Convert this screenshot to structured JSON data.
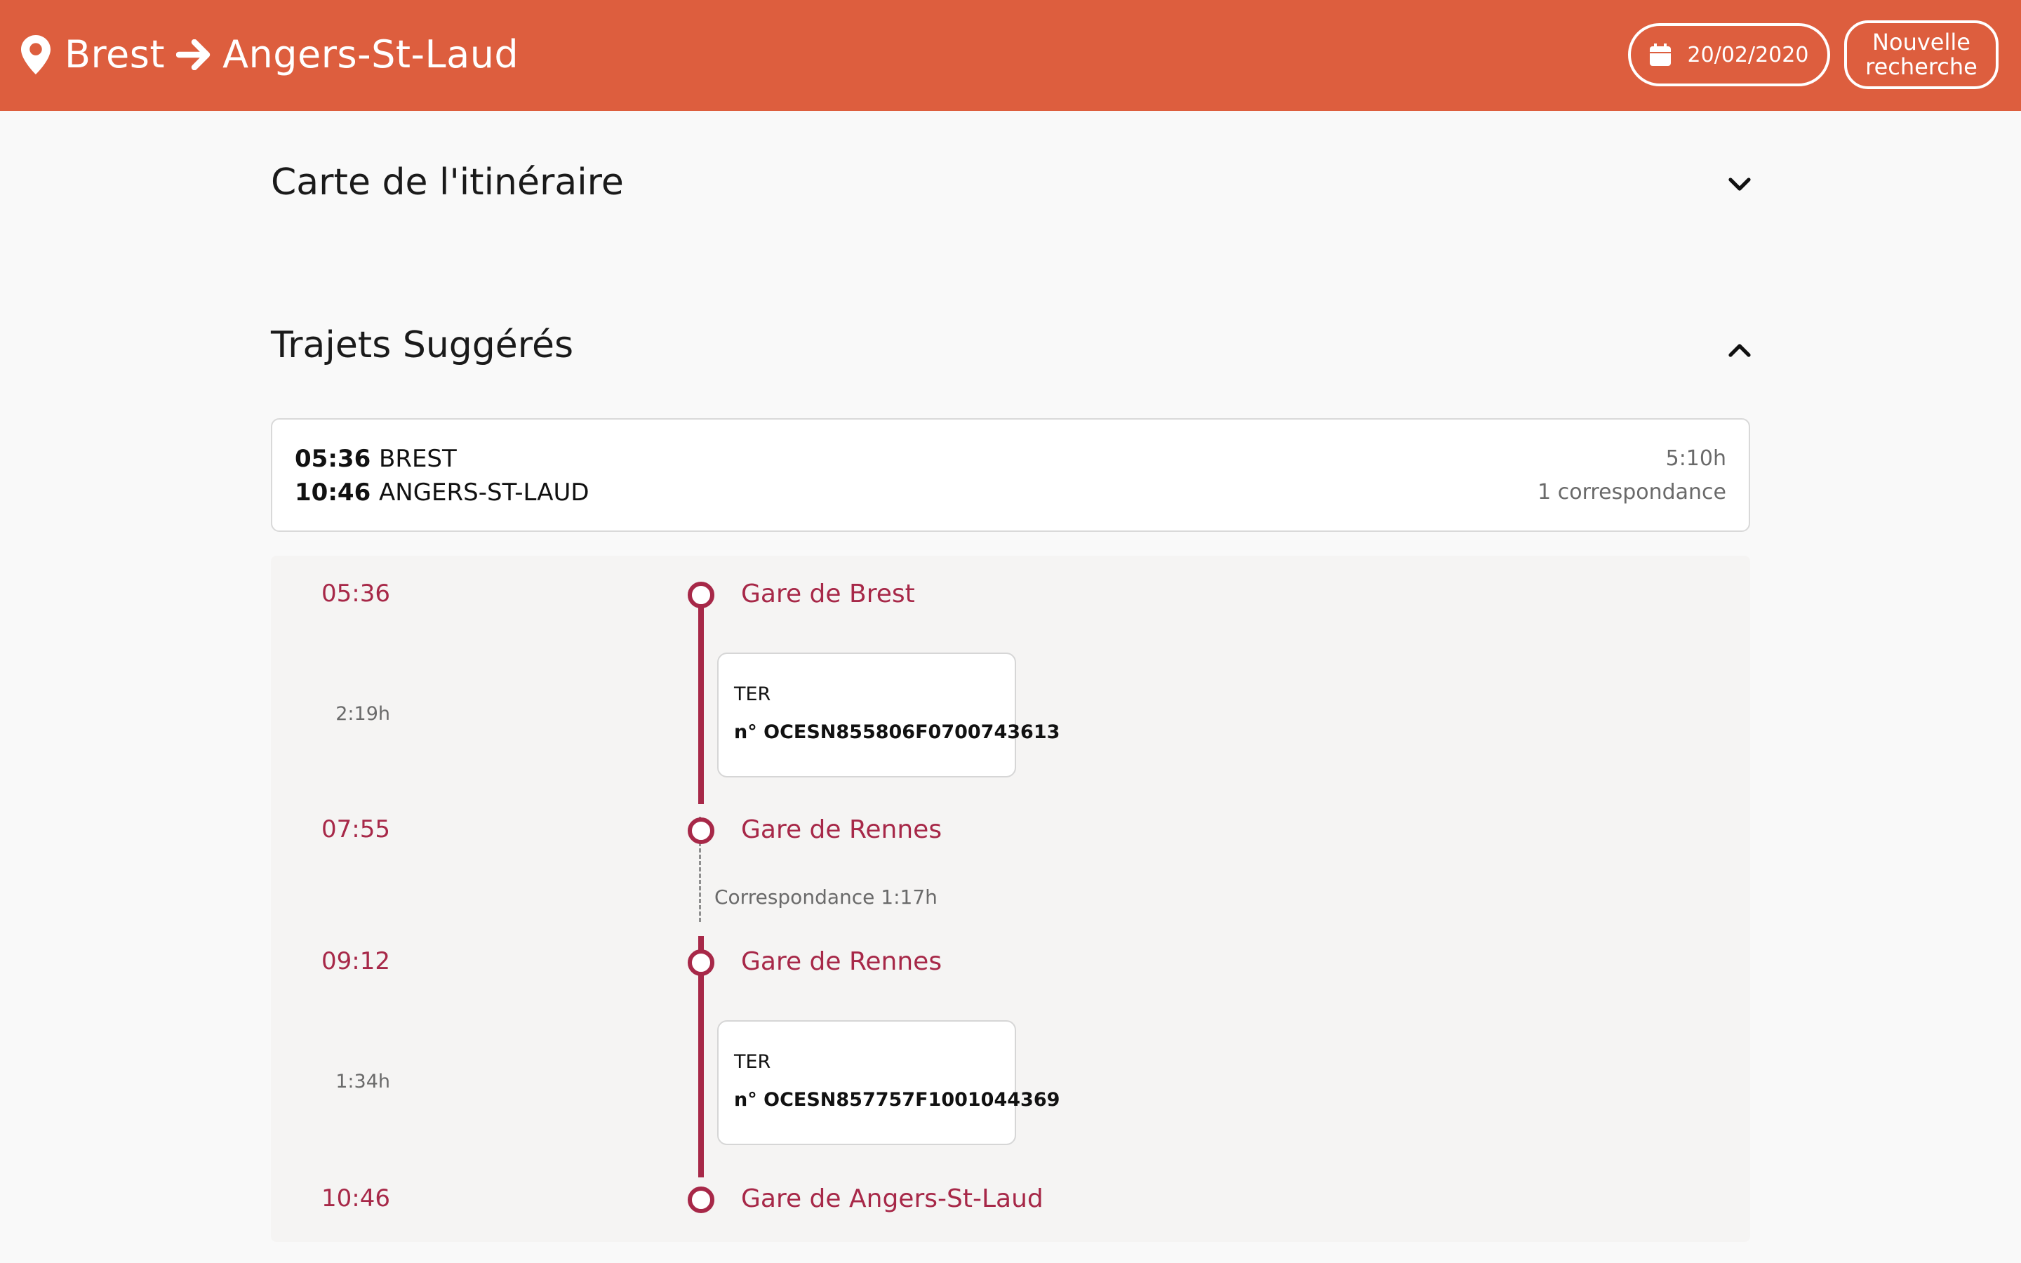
{
  "header": {
    "from": "Brest",
    "to": "Angers-St-Laud",
    "date": "20/02/2020",
    "new_search": "Nouvelle recherche",
    "background_color": "#dd5e3e"
  },
  "sections": {
    "map_title": "Carte de l'itinéraire",
    "routes_title": "Trajets Suggérés"
  },
  "summary": {
    "dep_time": "05:36",
    "dep_station": "BREST",
    "arr_time": "10:46",
    "arr_station": "ANGERS-ST-LAUD",
    "duration": "5:10h",
    "connections": "1 correspondance"
  },
  "timeline": {
    "accent_color": "#a72848",
    "stops": [
      {
        "time": "05:36",
        "station": "Gare de Brest"
      },
      {
        "time": "07:55",
        "station": "Gare de Rennes"
      },
      {
        "time": "09:12",
        "station": "Gare de Rennes"
      },
      {
        "time": "10:46",
        "station": "Gare de Angers-St-Laud"
      }
    ],
    "legs": [
      {
        "duration": "2:19h",
        "type": "TER",
        "number": "n° OCESN855806F0700743613"
      },
      {
        "duration": "1:34h",
        "type": "TER",
        "number": "n° OCESN857757F1001044369"
      }
    ],
    "connection_label": "Correspondance 1:17h"
  },
  "icons": [
    "map-pin-icon",
    "arrow-right-icon",
    "calendar-icon",
    "chevron-down-icon",
    "chevron-up-icon"
  ]
}
